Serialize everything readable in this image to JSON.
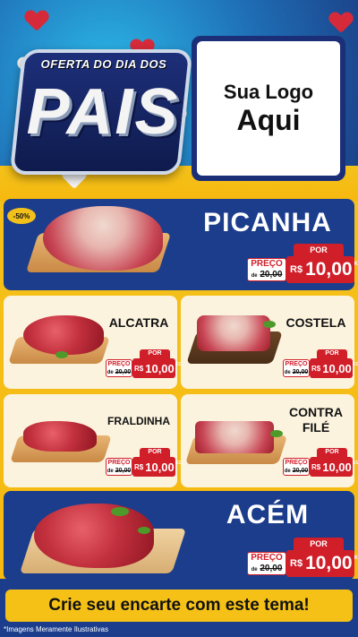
{
  "header": {
    "title_top": "OFERTA DO DIA DOS",
    "title_main": "PAIS",
    "logo_line1": "Sua Logo",
    "logo_line2": "Aqui"
  },
  "products": [
    {
      "name": "PICANHA",
      "badge": "-50%",
      "por": "POR",
      "preco_label": "PREÇO",
      "de_label": "de",
      "old_price": "20,00",
      "currency": "R$",
      "price": "10,00",
      "unit": "KG"
    },
    {
      "name": "ALCATRA",
      "por": "POR",
      "preco_label": "PREÇO",
      "de_label": "de",
      "old_price": "20,00",
      "currency": "R$",
      "price": "10,00",
      "unit": "KG"
    },
    {
      "name": "COSTELA",
      "por": "POR",
      "preco_label": "PREÇO",
      "de_label": "de",
      "old_price": "20,00",
      "currency": "R$",
      "price": "10,00",
      "unit": "KG"
    },
    {
      "name": "FRALDINHA",
      "por": "POR",
      "preco_label": "PREÇO",
      "de_label": "de",
      "old_price": "20,00",
      "currency": "R$",
      "price": "10,00",
      "unit": "KG"
    },
    {
      "name_line1": "CONTRA",
      "name_line2": "FILÉ",
      "por": "POR",
      "preco_label": "PREÇO",
      "de_label": "de",
      "old_price": "20,00",
      "currency": "R$",
      "price": "10,00",
      "unit": "KG"
    },
    {
      "name": "ACÉM",
      "por": "POR",
      "preco_label": "PREÇO",
      "de_label": "de",
      "old_price": "20,00",
      "currency": "R$",
      "price": "10,00",
      "unit": "KG"
    }
  ],
  "footer": {
    "cta": "Crie seu encarte com este tema!",
    "disclaimer": "*Imagens Meramente Ilustrativas"
  },
  "colors": {
    "accent_red": "#d11f2a",
    "navy": "#1b3d8c",
    "yellow": "#f5c116"
  }
}
